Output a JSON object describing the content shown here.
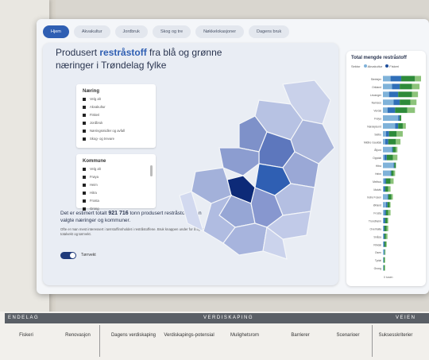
{
  "tabs": [
    {
      "label": "Hjem",
      "active": true
    },
    {
      "label": "Akvakultur"
    },
    {
      "label": "Jordbruk"
    },
    {
      "label": "Skog og tre"
    },
    {
      "label": "Nøkkelokasjoner"
    },
    {
      "label": "Dagens bruk"
    }
  ],
  "title_pre": "Produsert ",
  "title_highlight": "restråstoff",
  "title_post": " fra blå og grønne næringer i Trøndelag fylke",
  "naering_panel": {
    "heading": "Næring",
    "items": [
      "Velg alt",
      "Akvakultur",
      "Fiskeri",
      "Jordbruk",
      "Næringsmidler og avfall",
      "Skog- og trevare"
    ]
  },
  "kommune_panel": {
    "heading": "Kommune",
    "items": [
      "Velg alt",
      "Frøya",
      "Heim",
      "Hitra",
      "Frosta",
      "Grong"
    ]
  },
  "estimate_pre": "Det er estimert totalt ",
  "estimate_value": "921 716",
  "estimate_post": " tonn produsert restråstoff innen valgte næringer og kommuner.",
  "note_text": "Ofte er man mest interessert i tørrstoffinnholdet i restråstoffene. Bruk knappen under for å bytte mellom totalvekt og tørrvekt.",
  "toggle_label": "Tørrvekt",
  "right_panel": {
    "title": "Total mengde restråstoff",
    "legend_prefix": "Sektor",
    "legend": [
      {
        "label": "Akvakultur",
        "color": "#7fb2d9"
      },
      {
        "label": "Fiskeri",
        "color": "#1f4e9c"
      }
    ],
    "axis_end": "0 tusen"
  },
  "colors": {
    "accent": "#2f5fb3",
    "green": "#2e8b3a",
    "lightgreen": "#8cc37a",
    "blue": "#2f6fb8",
    "lightblue": "#7fb2d9"
  },
  "chart_data": {
    "type": "bar",
    "orientation": "horizontal",
    "stacked": true,
    "categories": [
      "Steinkjer",
      "Orkland",
      "Levanger",
      "Namsos",
      "Verdal",
      "Frøya",
      "Nærøysund",
      "Selbu",
      "Midtre Gauldal",
      "Åfjord",
      "Oppdal",
      "Hitra",
      "Heim",
      "Melhus",
      "Malvik",
      "Indre Fosen",
      "Ørland",
      "Frosta",
      "Trondheim",
      "Overhalla",
      "Snåsa",
      "Rindal",
      "Osen",
      "Tydal",
      "Grong"
    ],
    "series": [
      {
        "name": "Akvakultur",
        "values": [
          10,
          12,
          8,
          14,
          6,
          20,
          16,
          4,
          3,
          12,
          2,
          14,
          10,
          2,
          1,
          6,
          4,
          2,
          1,
          1,
          1,
          1,
          2,
          1,
          1
        ]
      },
      {
        "name": "Fiskeri",
        "values": [
          14,
          10,
          12,
          8,
          10,
          2,
          4,
          4,
          4,
          1,
          3,
          1,
          1,
          2,
          2,
          1,
          2,
          2,
          2,
          1,
          1,
          1,
          0,
          0,
          0
        ]
      },
      {
        "name": "Jordbruk",
        "values": [
          18,
          16,
          18,
          14,
          16,
          2,
          6,
          10,
          10,
          4,
          8,
          2,
          3,
          6,
          4,
          4,
          3,
          3,
          3,
          3,
          2,
          2,
          1,
          1,
          1
        ]
      },
      {
        "name": "Skog- og trevare",
        "values": [
          8,
          10,
          8,
          8,
          10,
          0,
          4,
          8,
          6,
          2,
          6,
          0,
          2,
          4,
          3,
          2,
          1,
          3,
          1,
          2,
          2,
          1,
          0,
          1,
          1
        ]
      }
    ]
  },
  "bottom": {
    "head_left": "ENDELAG",
    "head_mid": "VERDISKAPING",
    "head_right": "VEIEN",
    "items": [
      "Fiskeri",
      "Renovasjon",
      "Dagens verdiskaping",
      "Verdiskapings-potensial",
      "Mulighetsrom",
      "Barrierer",
      "Scenarioer",
      "Suksesskriterier"
    ]
  }
}
